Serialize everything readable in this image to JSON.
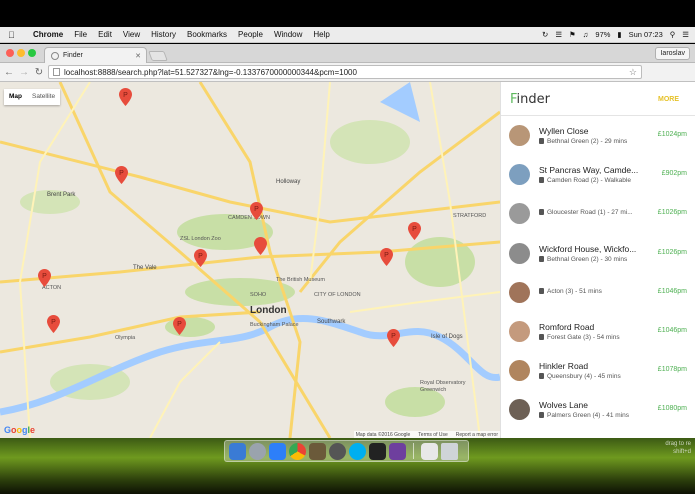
{
  "menubar": {
    "app_name": "Chrome",
    "items": [
      "File",
      "Edit",
      "View",
      "History",
      "Bookmarks",
      "People",
      "Window",
      "Help"
    ],
    "battery": "97%",
    "clock": "Sun 07:23"
  },
  "browser": {
    "tab_title": "Finder",
    "profile": "Iaroslav",
    "url": "localhost:8888/search.php?lat=51.527327&lng=-0.1337670000000344&pcm=1000"
  },
  "map": {
    "mode_map": "Map",
    "mode_satellite": "Satellite",
    "labels": {
      "brent_park": "Brent Park",
      "holloway": "Holloway",
      "camden_town": "CAMDEN TOWN",
      "zsl": "ZSL London Zoo",
      "stratford": "STRATFORD",
      "the_vale": "The Vale",
      "acton": "ACTON",
      "british_museum": "The British Museum",
      "soho": "SOHO",
      "london": "London",
      "city_of_london": "CITY OF LONDON",
      "buckingham": "Buckingham Palace",
      "southwark": "Southwark",
      "olympia": "Olympia",
      "isle_of_dogs": "Isle of Dogs",
      "royal_observatory": "Royal Observatory Greenwich",
      "google": "Google",
      "map_data": "Map data ©2016 Google",
      "terms": "Terms of Use",
      "report": "Report a map error"
    },
    "pin_count": 11
  },
  "panel": {
    "brand_first": "F",
    "brand_rest": "inder",
    "more": "MORE",
    "results": [
      {
        "title": "Wyllen Close",
        "meta": "Bethnal Green (2) - 29 mins",
        "price": "£1024pm"
      },
      {
        "title": "St Pancras Way, Camde...",
        "meta": "Camden Road (2) - Walkable",
        "price": "£902pm"
      },
      {
        "title": "",
        "meta": "Gloucester Road (1) - 27 mi...",
        "price": "£1026pm"
      },
      {
        "title": "Wickford House, Wickfo...",
        "meta": "Bethnal Green (2) - 30 mins",
        "price": "£1026pm"
      },
      {
        "title": "",
        "meta": "Acton (3) - 51 mins",
        "price": "£1046pm"
      },
      {
        "title": "Romford Road",
        "meta": "Forest Gate (3) - 54 mins",
        "price": "£1046pm"
      },
      {
        "title": "Hinkler Road",
        "meta": "Queensbury (4) - 45 mins",
        "price": "£1078pm"
      },
      {
        "title": "Wolves Lane",
        "meta": "Palmers Green (4) - 41 mins",
        "price": "£1080pm"
      }
    ]
  },
  "desktop": {
    "hint_line1": "drag to re",
    "hint_line2": "shift+d"
  },
  "colors": {
    "accent_green": "#4caf50",
    "more_yellow": "#e6c229",
    "pin_red": "#e74c3c"
  }
}
